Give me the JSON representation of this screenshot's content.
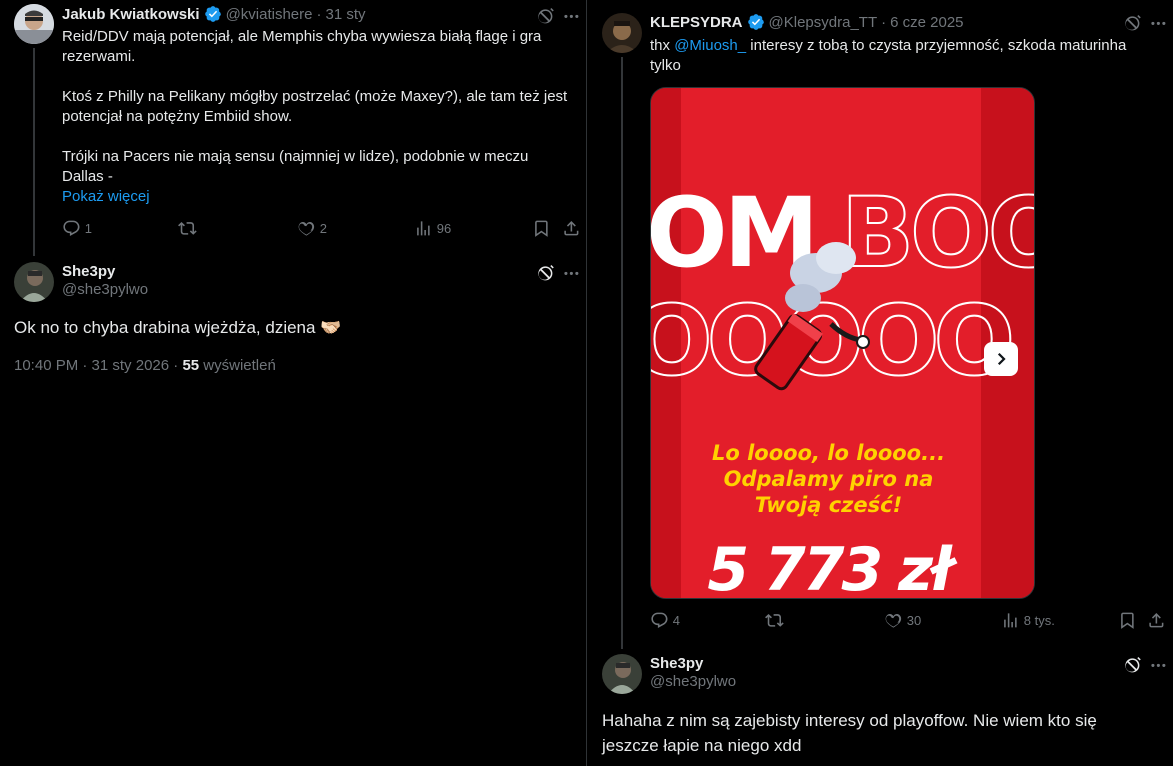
{
  "left": {
    "parent_tweet": {
      "name": "Jakub Kwiatkowski",
      "handle": "@kviatishere",
      "sep": "·",
      "time": "31 sty",
      "lines": [
        "Reid/DDV mają potencjał, ale Memphis chyba wywiesza białą flagę i gra",
        "rezerwami.",
        "Ktoś z Philly na Pelikany mógłby postrzelać (może Maxey?), ale tam też jest",
        "potencjał na potężny Embiid show.",
        "Trójki na Pacers nie mają sensu (najmniej w lidze), podobnie w meczu",
        "Dallas -"
      ],
      "show_more": "Pokaż więcej",
      "replies": "1",
      "retweets": "",
      "likes": "2",
      "views": "96"
    },
    "reply_tweet": {
      "name": "She3py",
      "handle": "@she3pylwo",
      "text": "Ok no to chyba drabina wjeżdża, dziena 🫱🏻‍🫲🏼",
      "time": "10:40 PM · 31 sty 2026 ·",
      "views_count": "55",
      "views_label": "wyświetleń"
    }
  },
  "right": {
    "parent_tweet": {
      "name": "KLEPSYDRA",
      "handle": "@Klepsydra_TT",
      "sep": "·",
      "time": "6 cze 2025",
      "text_prefix": "thx ",
      "mention": "@Miuosh_",
      "text_rest": " interesy z tobą to czysta przyjemność, szkoda maturinha",
      "text_line2": "tylko",
      "replies": "4",
      "retweets": "",
      "likes": "30",
      "views": "8 tys.",
      "media": {
        "bg_word_top": "BOOM BOO",
        "bg_word_mid": "OOOOOOO",
        "line1": "Lo loooo, lo loooo...",
        "line2": "Odpalamy piro na",
        "line3": "Twoją cześć!",
        "amount": "5 773 zł",
        "colors": {
          "red": "#e31e2a",
          "dark_red": "#c7111c",
          "yellow": "#ffd200"
        }
      }
    },
    "reply_tweet": {
      "name": "She3py",
      "handle": "@she3pylwo",
      "line1": "Hahaha z nim są zajebisty interesy od playoffow. Nie wiem kto się",
      "line2": "jeszcze łapie na niego xdd"
    }
  },
  "colors": {
    "accent": "#1d9bf0",
    "muted": "#71767b",
    "text": "#e7e9ea",
    "bg": "#000000"
  }
}
